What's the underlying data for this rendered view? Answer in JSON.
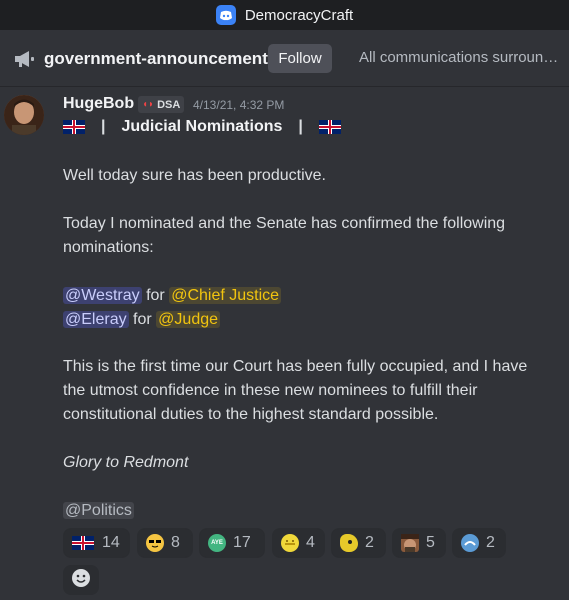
{
  "window": {
    "title": "DemocracyCraft"
  },
  "channel": {
    "name": "government-announcements",
    "follow_label": "Follow",
    "topic": "All communications surrounding the government"
  },
  "message": {
    "author": "HugeBob",
    "tag": "DSA",
    "timestamp": "4/13/21, 4:32 PM",
    "heading": "Judicial Nominations",
    "heading_separator": "|",
    "line1": "Well today sure has been productive.",
    "line2": "Today I nominated and the Senate has confirmed the following nominations:",
    "nominations": [
      {
        "user": "@Westray",
        "for": "for",
        "role": "@Chief Justice"
      },
      {
        "user": "@Eleray",
        "for": "for",
        "role": "@Judge"
      }
    ],
    "paragraph": "This is the first time our Court has been fully occupied, and I have the utmost confidence in these new nominees to fulfill their constitutional duties to the highest standard possible.",
    "signoff": "Glory to Redmont",
    "role_mention": "@Politics"
  },
  "reactions": [
    {
      "icon": "uk-flag-icon",
      "count": "14"
    },
    {
      "icon": "sunglasses-emoji-icon",
      "count": "8"
    },
    {
      "icon": "aye-emoji-icon",
      "count": "17",
      "label": "AYE"
    },
    {
      "icon": "yellow-face-emoji-icon",
      "count": "4"
    },
    {
      "icon": "yellow-blob-emoji-icon",
      "count": "2"
    },
    {
      "icon": "person-face-emoji-icon",
      "count": "5"
    },
    {
      "icon": "blue-circle-emoji-icon",
      "count": "2"
    }
  ],
  "colors": {
    "background": "#313338",
    "titlebar": "#1e1f22",
    "mention": "#c9cdfb",
    "role_mention": "#f1c40f"
  }
}
